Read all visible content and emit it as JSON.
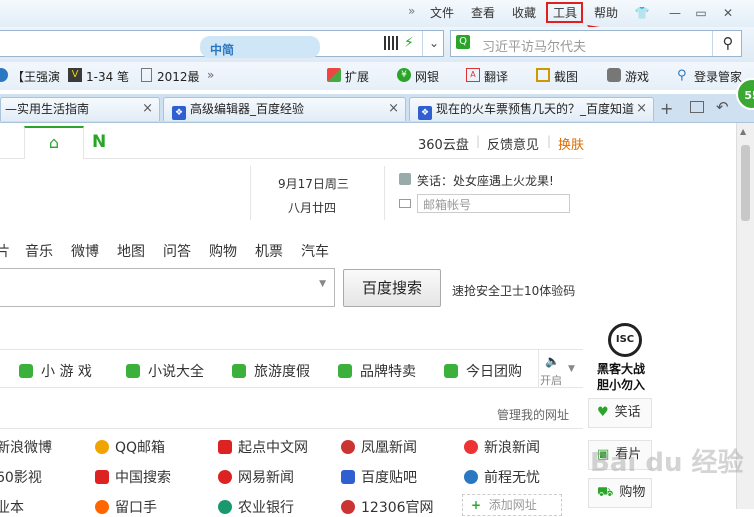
{
  "menu": {
    "more": "»",
    "file": "文件",
    "view": "查看",
    "favorites": "收藏",
    "tools": "工具",
    "help": "帮助"
  },
  "window": {
    "skin": "👕",
    "minimize": "—",
    "restore": "▭",
    "close": "✕"
  },
  "address": {
    "skin_label": "中简",
    "search_placeholder": "习近平访马尔代夫"
  },
  "bookmarks": [
    {
      "label": "【王强演"
    },
    {
      "label": "1-34 笔"
    },
    {
      "label": "2012最"
    },
    {
      "label": "»"
    }
  ],
  "toolbar": [
    {
      "label": "扩展"
    },
    {
      "label": "网银"
    },
    {
      "label": "翻译"
    },
    {
      "label": "截图"
    },
    {
      "label": "游戏"
    },
    {
      "label": "登录管家"
    }
  ],
  "badge": "55",
  "tabs": [
    {
      "title": "—实用生活指南"
    },
    {
      "title": "高级编辑器_百度经验"
    },
    {
      "title": "现在的火车票预售几天的？_百度知道"
    }
  ],
  "page": {
    "top_links": [
      "360云盘",
      "反馈意见",
      "换肤"
    ],
    "date": "9月17日周三",
    "lunar": "八月廿四",
    "joke": "笑话：处女座遇上火龙果!",
    "email_placeholder": "邮箱帐号",
    "search_tabs": [
      "片",
      "音乐",
      "微博",
      "地图",
      "问答",
      "购物",
      "机票",
      "汽车"
    ],
    "search_button": "百度搜索",
    "search_tip": "速抢安全卫士10体验码",
    "categories": [
      "小 游 戏",
      "小说大全",
      "旅游度假",
      "品牌特卖",
      "今日团购"
    ],
    "sound_label": "开启",
    "manage_link": "管理我的网址",
    "sites": [
      [
        "新浪微博",
        "QQ邮箱",
        "起点中文网",
        "凤凰新闻",
        "新浪新闻"
      ],
      [
        "60影视",
        "中国搜索",
        "网易新闻",
        "百度贴吧",
        "前程无忧"
      ],
      [
        "业本",
        "留口手",
        "农业银行",
        "12306官网",
        "添加网址"
      ]
    ],
    "isc_logo": "ISC",
    "isc_line1": "黑客大战",
    "isc_line2": "胆小勿入",
    "side_buttons": [
      "笑话",
      "看片",
      "购物"
    ],
    "watermark": "Bai du 经验"
  },
  "colors": {
    "accent": "#e02020",
    "green": "#2aa52a",
    "link_blue": "#1a5fb4"
  }
}
